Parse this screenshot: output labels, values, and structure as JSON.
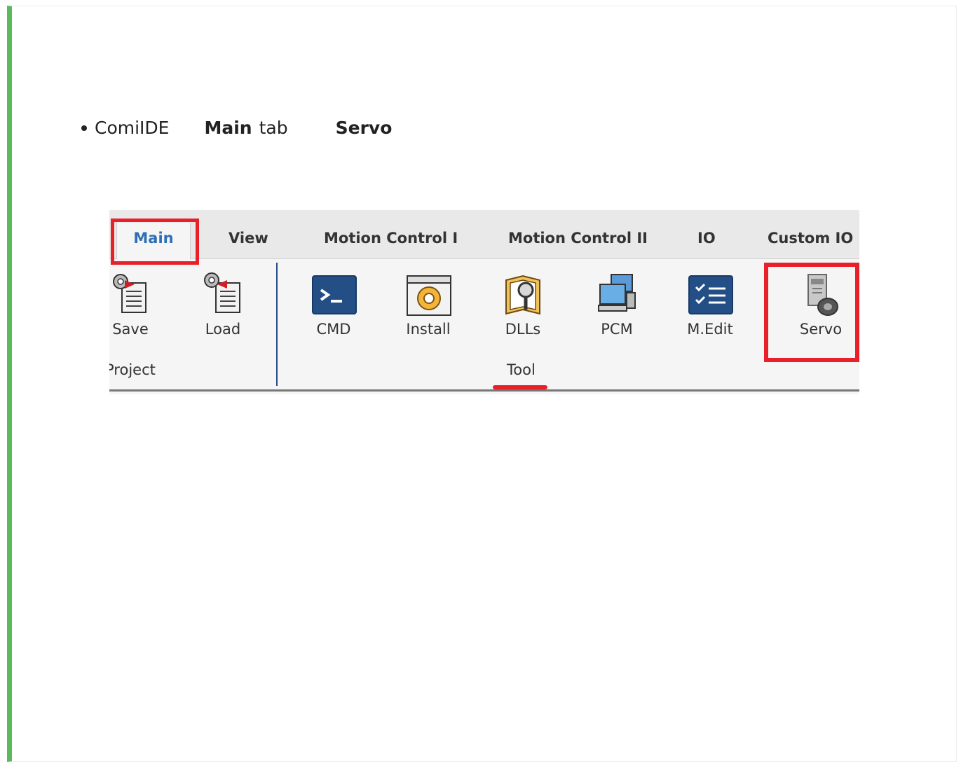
{
  "instruction": {
    "app": "ComiIDE",
    "tab_name": "Main",
    "tab_word": "tab",
    "target": "Servo"
  },
  "tabs": [
    "Main",
    "View",
    "Motion Control I",
    "Motion Control II",
    "IO",
    "Custom IO"
  ],
  "project_group": {
    "label": "Project",
    "buttons": [
      {
        "label": "Save",
        "icon": "save-project-icon"
      },
      {
        "label": "Load",
        "icon": "load-project-icon"
      }
    ]
  },
  "tool_group": {
    "label": "Tool",
    "buttons": [
      {
        "label": "CMD",
        "icon": "terminal-icon"
      },
      {
        "label": "Install",
        "icon": "install-gear-icon"
      },
      {
        "label": "DLLs",
        "icon": "dll-search-icon"
      },
      {
        "label": "PCM",
        "icon": "computers-icon"
      },
      {
        "label": "M.Edit",
        "icon": "checklist-icon"
      },
      {
        "label": "Servo",
        "icon": "servo-drive-icon"
      }
    ]
  },
  "colors": {
    "highlight": "#e8202a",
    "active_tab": "#2f6fb5",
    "left_accent": "#5cb85c"
  }
}
